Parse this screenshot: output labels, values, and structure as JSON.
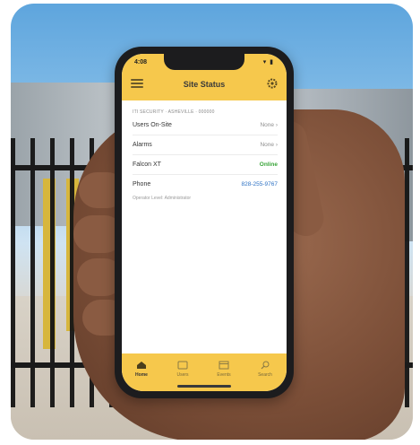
{
  "app": {
    "status_time": "4:08",
    "status_icons": "▾ ▮",
    "title": "Site Status",
    "subheading": "ITI SECURITY · ASHEVILLE · 000000"
  },
  "rows": [
    {
      "label": "Users On-Site",
      "value": "None  ›"
    },
    {
      "label": "Alarms",
      "value": "None  ›"
    },
    {
      "label": "Falcon XT",
      "value": "Online"
    },
    {
      "label": "Phone",
      "value": "828-255-9767"
    }
  ],
  "operator_note": "Operator Level: Administrator",
  "tabs": [
    {
      "label": "Home",
      "icon": "home-icon"
    },
    {
      "label": "Users",
      "icon": "users-icon"
    },
    {
      "label": "Events",
      "icon": "calendar-icon"
    },
    {
      "label": "Search",
      "icon": "search-icon"
    }
  ],
  "colors": {
    "accent": "#f6c84c",
    "online": "#3aa53a",
    "link": "#2e72c4"
  }
}
